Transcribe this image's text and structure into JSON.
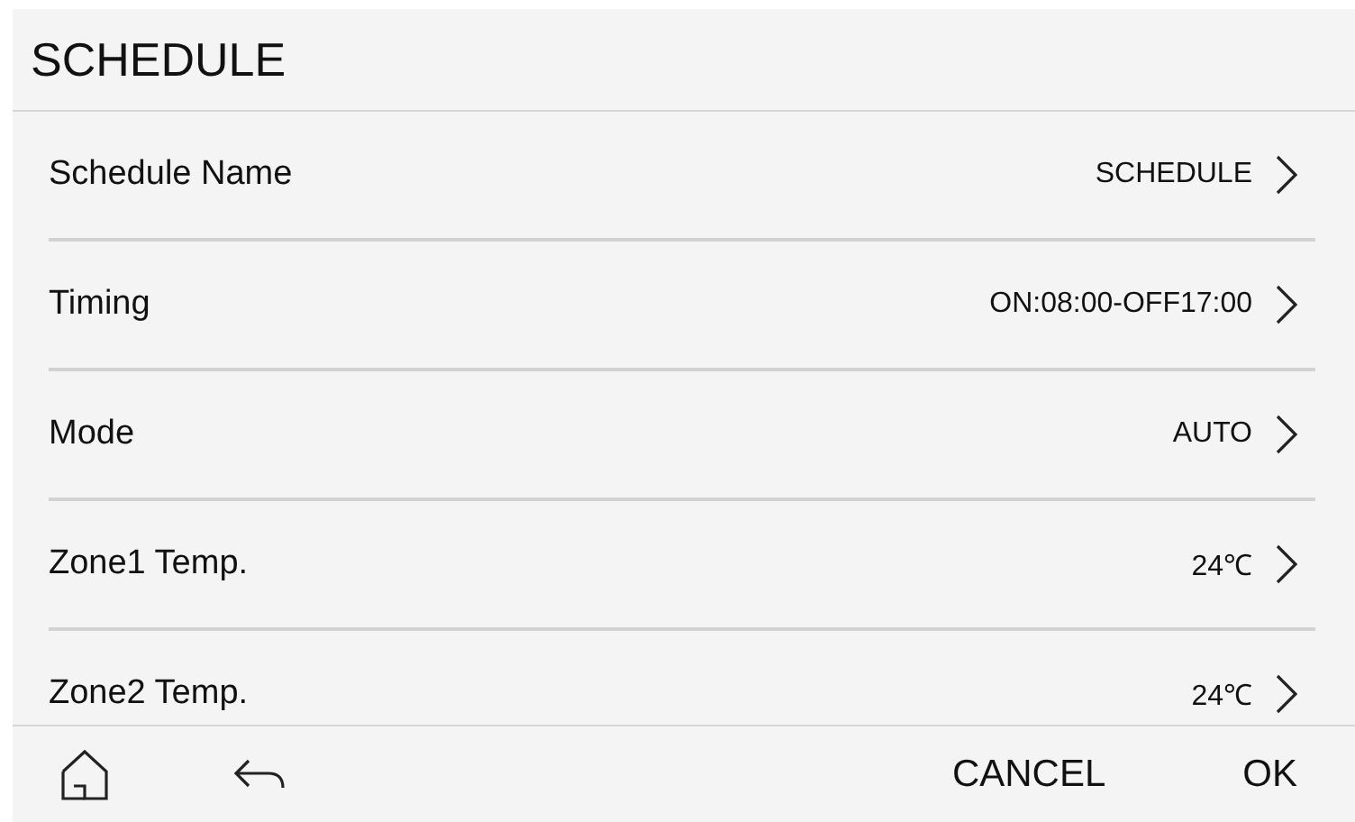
{
  "header": {
    "title": "SCHEDULE"
  },
  "rows": [
    {
      "label": "Schedule Name",
      "value": "SCHEDULE"
    },
    {
      "label": "Timing",
      "value": "ON:08:00-OFF17:00"
    },
    {
      "label": "Mode",
      "value": "AUTO"
    },
    {
      "label": "Zone1 Temp.",
      "value": "24℃"
    },
    {
      "label": "Zone2 Temp.",
      "value": "24℃"
    }
  ],
  "footer": {
    "cancel": "CANCEL",
    "ok": "OK"
  }
}
